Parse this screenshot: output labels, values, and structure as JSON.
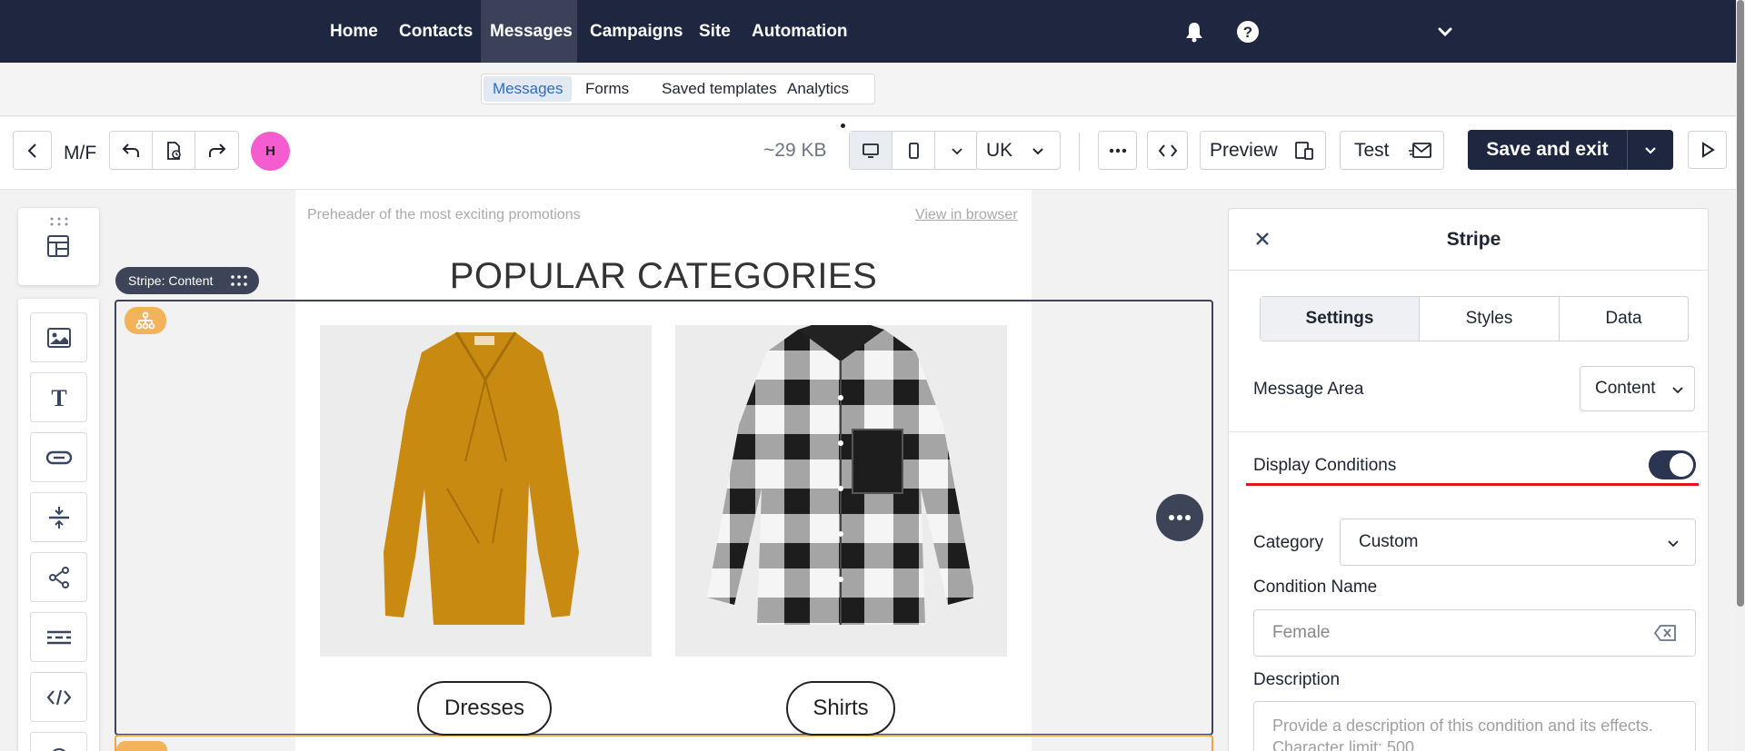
{
  "topnav": {
    "items": [
      "Home",
      "Contacts",
      "Messages",
      "Campaigns",
      "Site",
      "Automation"
    ],
    "active": "Messages",
    "icons": [
      "bell-icon",
      "help-icon",
      "chevron-down-icon"
    ]
  },
  "subnav": {
    "items": [
      "Messages",
      "Forms",
      "Saved templates",
      "Analytics"
    ],
    "active": "Messages"
  },
  "toolbar": {
    "message_name": "M/F",
    "avatar_initial": "H",
    "size": "~29 KB",
    "language": "UK",
    "preview_label": "Preview",
    "test_label": "Test",
    "save_exit_label": "Save and exit"
  },
  "canvas": {
    "preheader": "Preheader of the most exciting promotions",
    "view_in_browser": "View in browser",
    "title": "POPULAR CATEGORIES",
    "stripe_tag": "Stripe: Content",
    "products": [
      {
        "button": "Dresses"
      },
      {
        "button": "Shirts"
      }
    ]
  },
  "panel": {
    "title": "Stripe",
    "tabs": [
      "Settings",
      "Styles",
      "Data"
    ],
    "active_tab": "Settings",
    "message_area_label": "Message Area",
    "message_area_value": "Content",
    "display_conditions_label": "Display Conditions",
    "display_conditions_on": true,
    "category_label": "Category",
    "category_value": "Custom",
    "condition_name_label": "Condition Name",
    "condition_name_placeholder": "Female",
    "description_label": "Description",
    "description_placeholder": "Provide a description of this condition and its effects. Character limit: 500"
  },
  "colors": {
    "nav_bg": "#1e2640",
    "accent_pink": "#f55ccf",
    "condition_badge": "#f2b35a",
    "highlight_red": "#e3121b",
    "dress": "#c98a12"
  }
}
